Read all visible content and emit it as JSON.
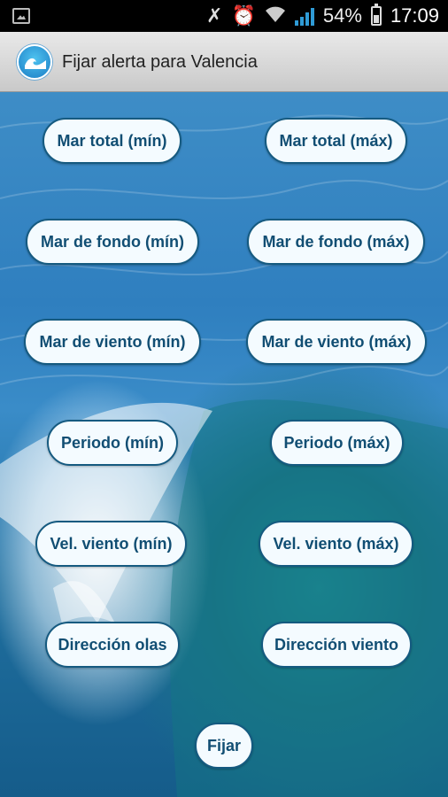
{
  "status_bar": {
    "battery_percent": "54%",
    "time": "17:09",
    "icons": [
      "gallery-icon",
      "mute-icon",
      "alarm-icon",
      "wifi-icon",
      "signal-icon",
      "battery-icon"
    ]
  },
  "app_bar": {
    "title": "Fijar alerta para Valencia"
  },
  "buttons": {
    "mar_total_min": "Mar total (mín)",
    "mar_total_max": "Mar total (máx)",
    "mar_fondo_min": "Mar de fondo (mín)",
    "mar_fondo_max": "Mar de fondo (máx)",
    "mar_viento_min": "Mar de viento (mín)",
    "mar_viento_max": "Mar de viento (máx)",
    "periodo_min": "Periodo (mín)",
    "periodo_max": "Periodo (máx)",
    "vel_viento_min": "Vel. viento (mín)",
    "vel_viento_max": "Vel. viento (máx)",
    "direccion_olas": "Dirección olas",
    "direccion_viento": "Dirección viento",
    "fijar": "Fijar"
  },
  "colors": {
    "button_bg": "#f4fbff",
    "button_border": "#155a80",
    "button_text": "#114e73"
  }
}
